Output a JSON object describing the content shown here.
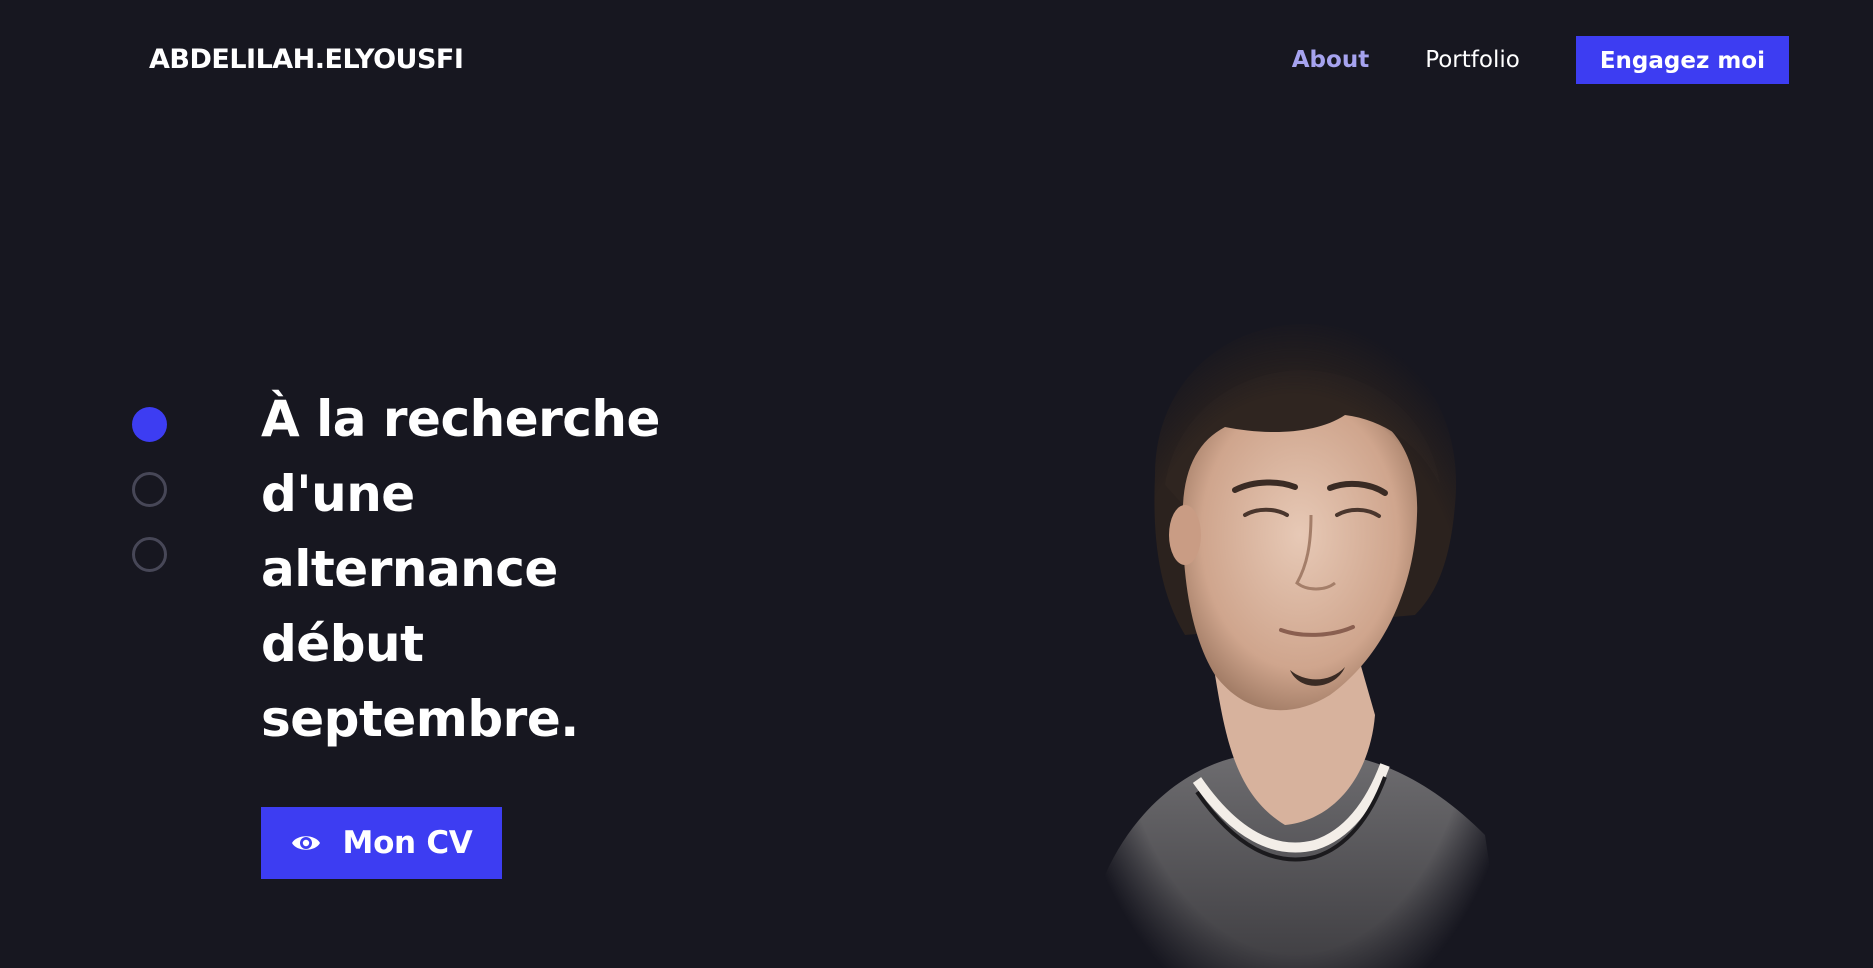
{
  "header": {
    "logo": "ABDELILAH.ELYOUSFI",
    "nav": {
      "about": "About",
      "portfolio": "Portfolio",
      "cta": "Engagez moi"
    }
  },
  "hero": {
    "headline": "À la recherche d'une alternance début septembre.",
    "cv_button_label": "Mon CV",
    "cv_button_icon": "eye-icon",
    "slides": {
      "count": 3,
      "active_index": 0
    }
  },
  "colors": {
    "background": "#171720",
    "accent": "#3d3df2",
    "nav_active": "#a6a3ef",
    "dot_inactive": "#474757"
  }
}
